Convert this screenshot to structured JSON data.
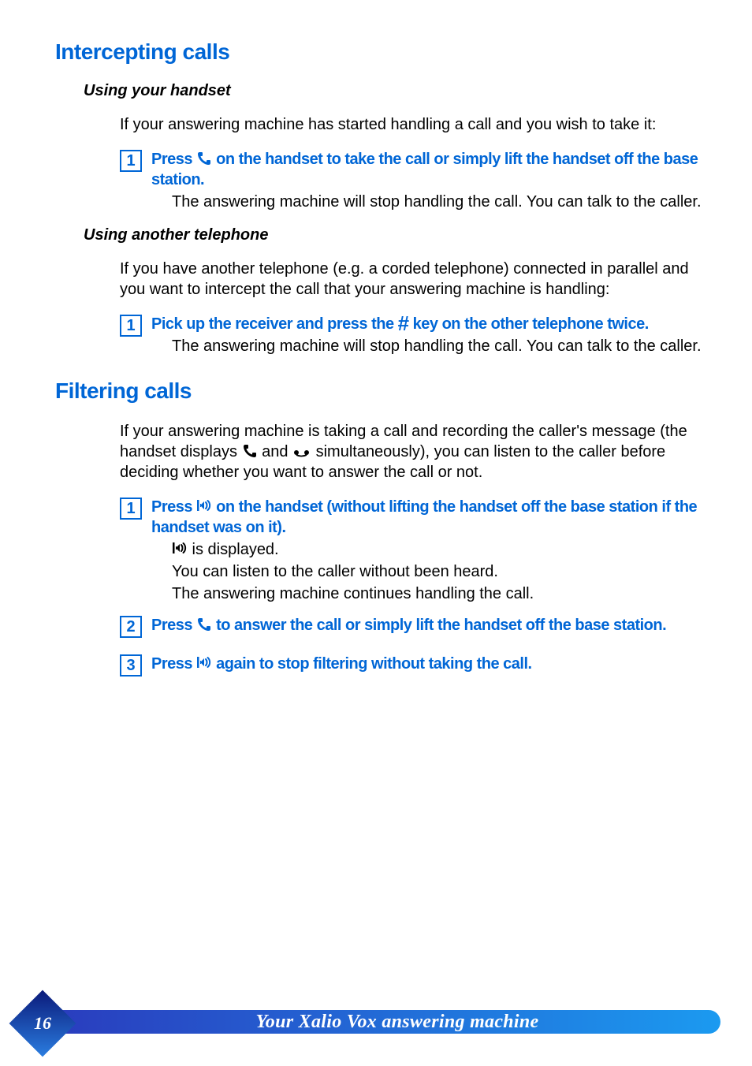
{
  "colors": {
    "accent": "#0066d6",
    "footer_gradient_start": "#2a3bbd",
    "footer_gradient_end": "#1b9af0",
    "diamond_fill_dark": "#0b1a7a",
    "diamond_fill_light": "#2a7de0"
  },
  "heading1": "Intercepting calls",
  "sub1": "Using your handset",
  "intro1": "If your answering machine has started handling a call and you wish to take it:",
  "step1_num": "1",
  "step1_a": "Press ",
  "step1_b": " on the handset to take the call or simply lift the handset off the base station.",
  "step1_result": "The answering machine will stop handling the call.  You can talk to the caller.",
  "sub2": "Using another telephone",
  "intro2": "If you have another telephone (e.g. a corded telephone) connected in parallel and you want to intercept the call that your answering machine is handling:",
  "step2_num": "1",
  "step2_a": "Pick up the receiver and press the ",
  "step2_hash": "#",
  "step2_b": " key on the other telephone twice.",
  "step2_result": "The answering machine will stop handling the call.  You can talk to the caller.",
  "heading2": "Filtering calls",
  "intro3_a": "If your answering machine is taking a call and recording the caller's message (the handset displays ",
  "intro3_b": " and ",
  "intro3_c": " simultaneously), you can listen to the caller before deciding whether you want to answer the call or not.",
  "fstep1_num": "1",
  "fstep1_a": "Press ",
  "fstep1_b": " on the handset (without lifting the handset off the base station if the handset was on it).",
  "fstep1_r1_b": " is displayed.",
  "fstep1_r2": "You can listen to the caller without been heard.",
  "fstep1_r3": "The answering machine continues handling the call.",
  "fstep2_num": "2",
  "fstep2_a": "Press ",
  "fstep2_b": " to answer the call or simply lift the handset off the base station.",
  "fstep3_num": "3",
  "fstep3_a": "Press ",
  "fstep3_b": " again to stop filtering without taking the call.",
  "page_number": "16",
  "footer_title": "Your Xalio Vox answering machine"
}
